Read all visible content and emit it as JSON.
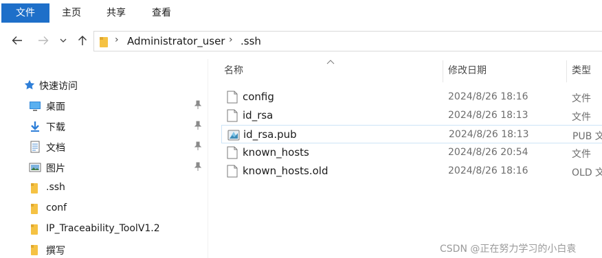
{
  "ribbon": {
    "tabs": [
      "文件",
      "主页",
      "共享",
      "查看"
    ]
  },
  "address": {
    "crumbs": [
      "Administrator_user",
      ".ssh"
    ]
  },
  "nav": {
    "quick_access": "快速访问",
    "items": [
      {
        "label": "桌面",
        "icon": "desktop-icon",
        "pinned": true
      },
      {
        "label": "下载",
        "icon": "download-icon",
        "pinned": true
      },
      {
        "label": "文档",
        "icon": "documents-icon",
        "pinned": true
      },
      {
        "label": "图片",
        "icon": "pictures-icon",
        "pinned": true
      },
      {
        "label": ".ssh",
        "icon": "folder-icon",
        "pinned": false
      },
      {
        "label": "conf",
        "icon": "folder-icon",
        "pinned": false
      },
      {
        "label": "IP_Traceability_ToolV1.2",
        "icon": "folder-icon",
        "pinned": false
      },
      {
        "label": "撰写",
        "icon": "folder-icon",
        "pinned": false
      }
    ]
  },
  "columns": {
    "name": "名称",
    "modified": "修改日期",
    "type": "类型"
  },
  "files": [
    {
      "name": "config",
      "date": "2024/8/26 18:16",
      "type": "文件",
      "icon": "file-icon"
    },
    {
      "name": "id_rsa",
      "date": "2024/8/26 18:13",
      "type": "文件",
      "icon": "file-icon"
    },
    {
      "name": "id_rsa.pub",
      "date": "2024/8/26 18:13",
      "type": "PUB 文",
      "icon": "pub-file-icon"
    },
    {
      "name": "known_hosts",
      "date": "2024/8/26 20:54",
      "type": "文件",
      "icon": "file-icon"
    },
    {
      "name": "known_hosts.old",
      "date": "2024/8/26 18:16",
      "type": "OLD 文",
      "icon": "file-icon"
    }
  ],
  "watermark": "CSDN @正在努力学习的小白袁",
  "colors": {
    "accent": "#1e6fc9",
    "selection_border": "#cce4f7",
    "folder": "#f5c243"
  }
}
